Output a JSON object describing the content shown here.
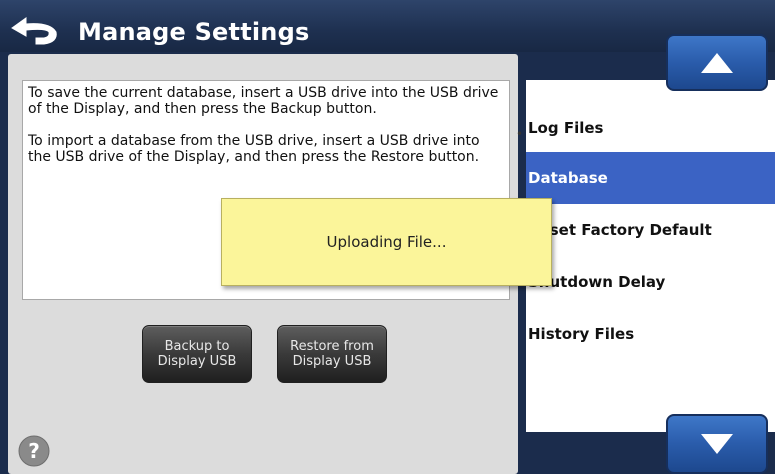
{
  "header": {
    "title": "Manage Settings"
  },
  "description": {
    "paragraph_1": "To save the current database, insert a USB drive into the USB drive of the Display, and then press the Backup button.",
    "paragraph_2": "To import a database from the USB drive, insert a USB drive into the USB drive of the Display, and then press the Restore button."
  },
  "buttons": {
    "backup_line1": "Backup to",
    "backup_line2": "Display USB",
    "restore_line1": "Restore from",
    "restore_line2": "Display USB"
  },
  "settings_list": {
    "items": [
      {
        "label": "Log Files"
      },
      {
        "label": "Database",
        "selected": true
      },
      {
        "label": "Reset Factory Default"
      },
      {
        "label": "Shutdown Delay"
      },
      {
        "label": "History Files"
      }
    ]
  },
  "dialog": {
    "message": "Uploading File..."
  },
  "icons": {
    "back": "back-arrow-icon",
    "help": "help-icon",
    "scroll_up": "arrow-up-icon",
    "scroll_down": "arrow-down-icon"
  },
  "colors": {
    "header_bg": "#1e3050",
    "selected_item": "#3b63c4",
    "scroll_button": "#2a5cab",
    "dialog_bg": "#fbf59a"
  }
}
